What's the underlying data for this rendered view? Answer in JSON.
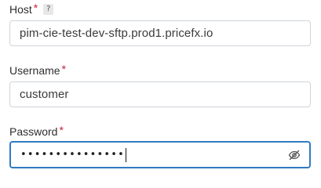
{
  "host": {
    "label": "Host",
    "required_mark": "*",
    "help_badge": "?",
    "value": "pim-cie-test-dev-sftp.prod1.pricefx.io"
  },
  "username": {
    "label": "Username",
    "required_mark": "*",
    "value": "customer"
  },
  "password": {
    "label": "Password",
    "required_mark": "*",
    "masked_value": "•••••••••••••••",
    "toggle_icon": "eye-slash-icon"
  },
  "colors": {
    "required": "#c81e3c",
    "focus_border": "#2f7bc4",
    "input_border": "#cfd3d8"
  }
}
